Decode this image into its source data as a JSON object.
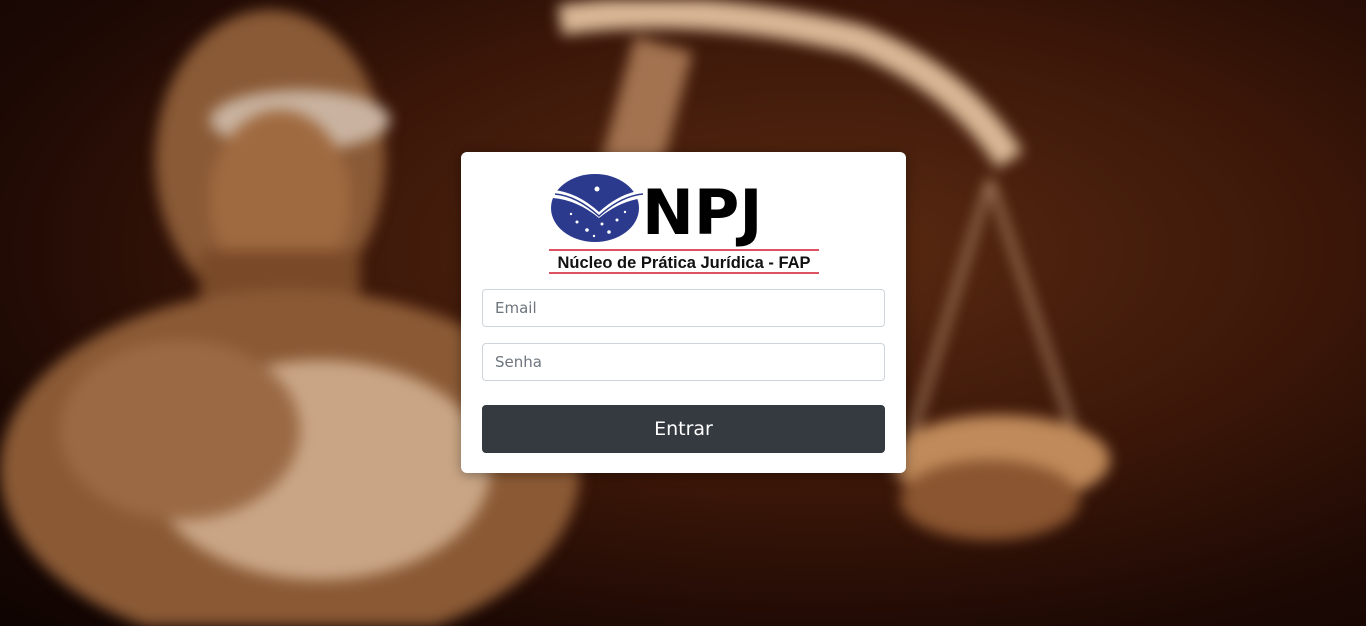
{
  "logo": {
    "acronym": "NPJ",
    "subtitle": "Núcleo de Prática Jurídica - FAP",
    "emblem_color": "#2b3a8c",
    "line_color": "#d1192b"
  },
  "form": {
    "email_placeholder": "Email",
    "password_placeholder": "Senha",
    "submit_label": "Entrar"
  },
  "colors": {
    "button_bg": "#343a40",
    "background_tone": "#3a1608"
  }
}
